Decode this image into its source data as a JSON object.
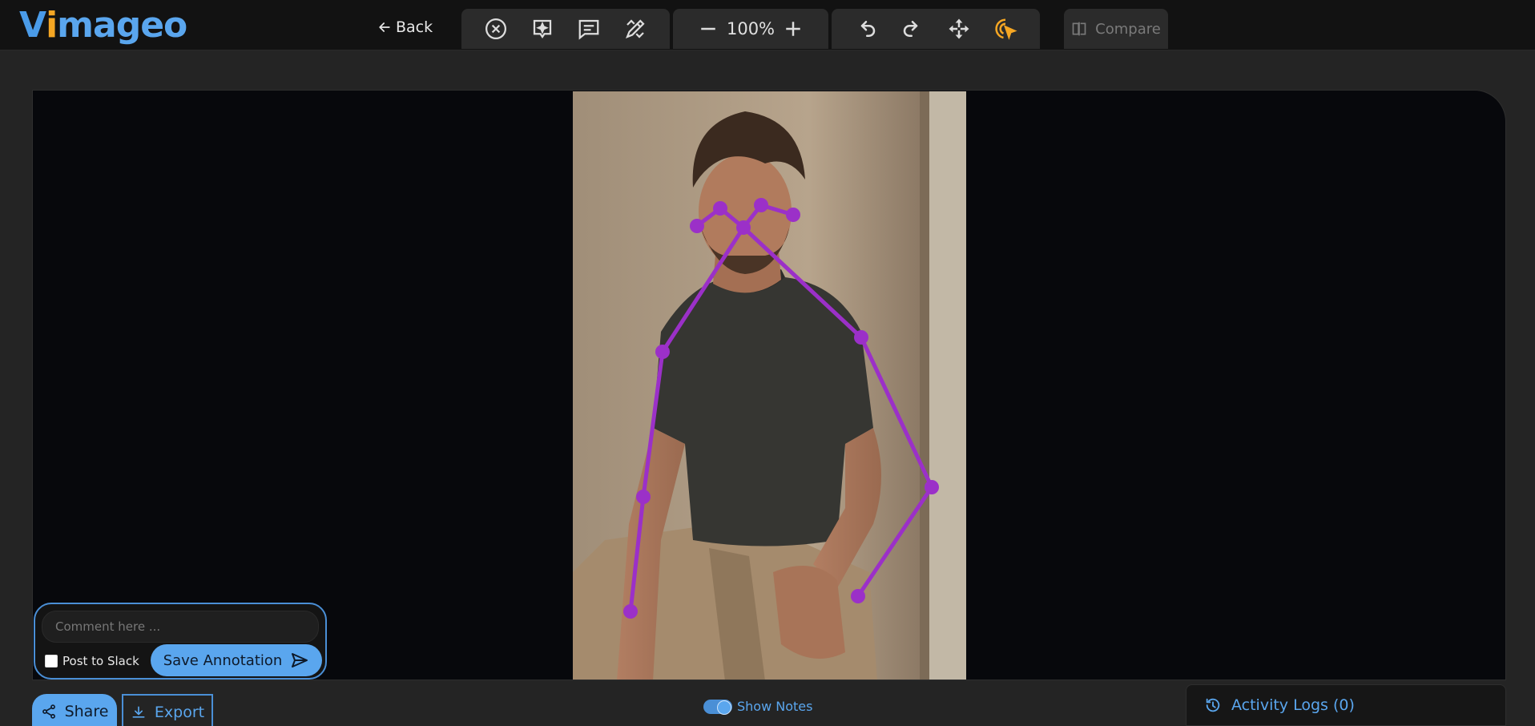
{
  "app": {
    "logo_v": "V",
    "logo_i": "i",
    "logo_rest": "mageo"
  },
  "nav": {
    "back_label": "Back"
  },
  "toolbar": {
    "zoom_value": "100%",
    "compare_label": "Compare",
    "accent": "#f5a623",
    "icons": [
      "close-circle-icon",
      "ai-sparkle-icon",
      "comment-icon",
      "pen-ruler-icon",
      "minus-icon",
      "plus-icon",
      "undo-icon",
      "redo-icon",
      "move-icon",
      "pointer-target-icon",
      "compare-icon"
    ]
  },
  "canvas": {
    "pose_color": "#9b30c8",
    "keypoints": [
      "nose",
      "left-eye",
      "right-eye",
      "left-ear",
      "right-ear",
      "left-shoulder",
      "right-shoulder",
      "left-elbow",
      "right-elbow",
      "left-wrist",
      "right-wrist"
    ]
  },
  "comment": {
    "placeholder": "Comment here ...",
    "post_to_slack_label": "Post to Slack",
    "save_label": "Save Annotation"
  },
  "footer": {
    "share_label": "Share",
    "export_label": "Export",
    "show_notes_label": "Show Notes",
    "activity_label": "Activity Logs (0)"
  }
}
